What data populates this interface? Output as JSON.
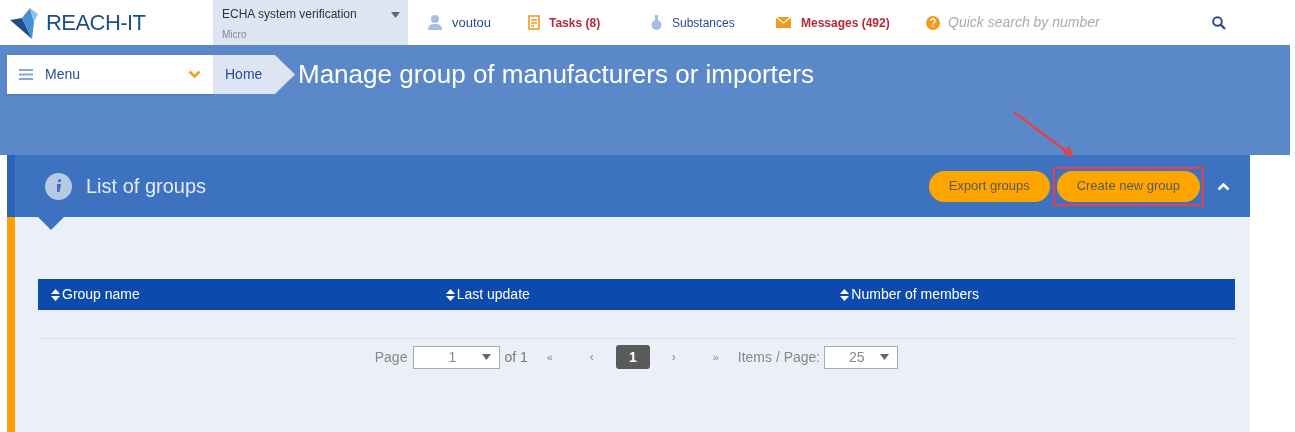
{
  "header": {
    "logo": "REACH-IT",
    "organisation": {
      "name": "ECHA system verification",
      "size": "Micro"
    },
    "user": "voutou",
    "tasks": "Tasks (8)",
    "substances": "Substances",
    "messages": "Messages (492)",
    "search": {
      "placeholder": "Quick search by number"
    }
  },
  "nav": {
    "menu": "Menu",
    "breadcrumb": "Home",
    "title": "Manage group of manufacturers or importers"
  },
  "panel": {
    "title": "List of groups",
    "expanded": true,
    "buttons": [
      {
        "label": "Export groups",
        "highlighted": false
      },
      {
        "label": "Create new group",
        "highlighted": true
      }
    ]
  },
  "table": {
    "columns": [
      "Group name",
      "Last update",
      "Number of members"
    ]
  },
  "pagination": {
    "page_label": "Page",
    "page_value": "1",
    "of": "of 1",
    "first": "«",
    "prev": "‹",
    "pages": [
      {
        "label": "1",
        "selected": true
      }
    ],
    "next": "›",
    "last": "»",
    "items_label": "Items / Page:",
    "items_value": "25"
  }
}
